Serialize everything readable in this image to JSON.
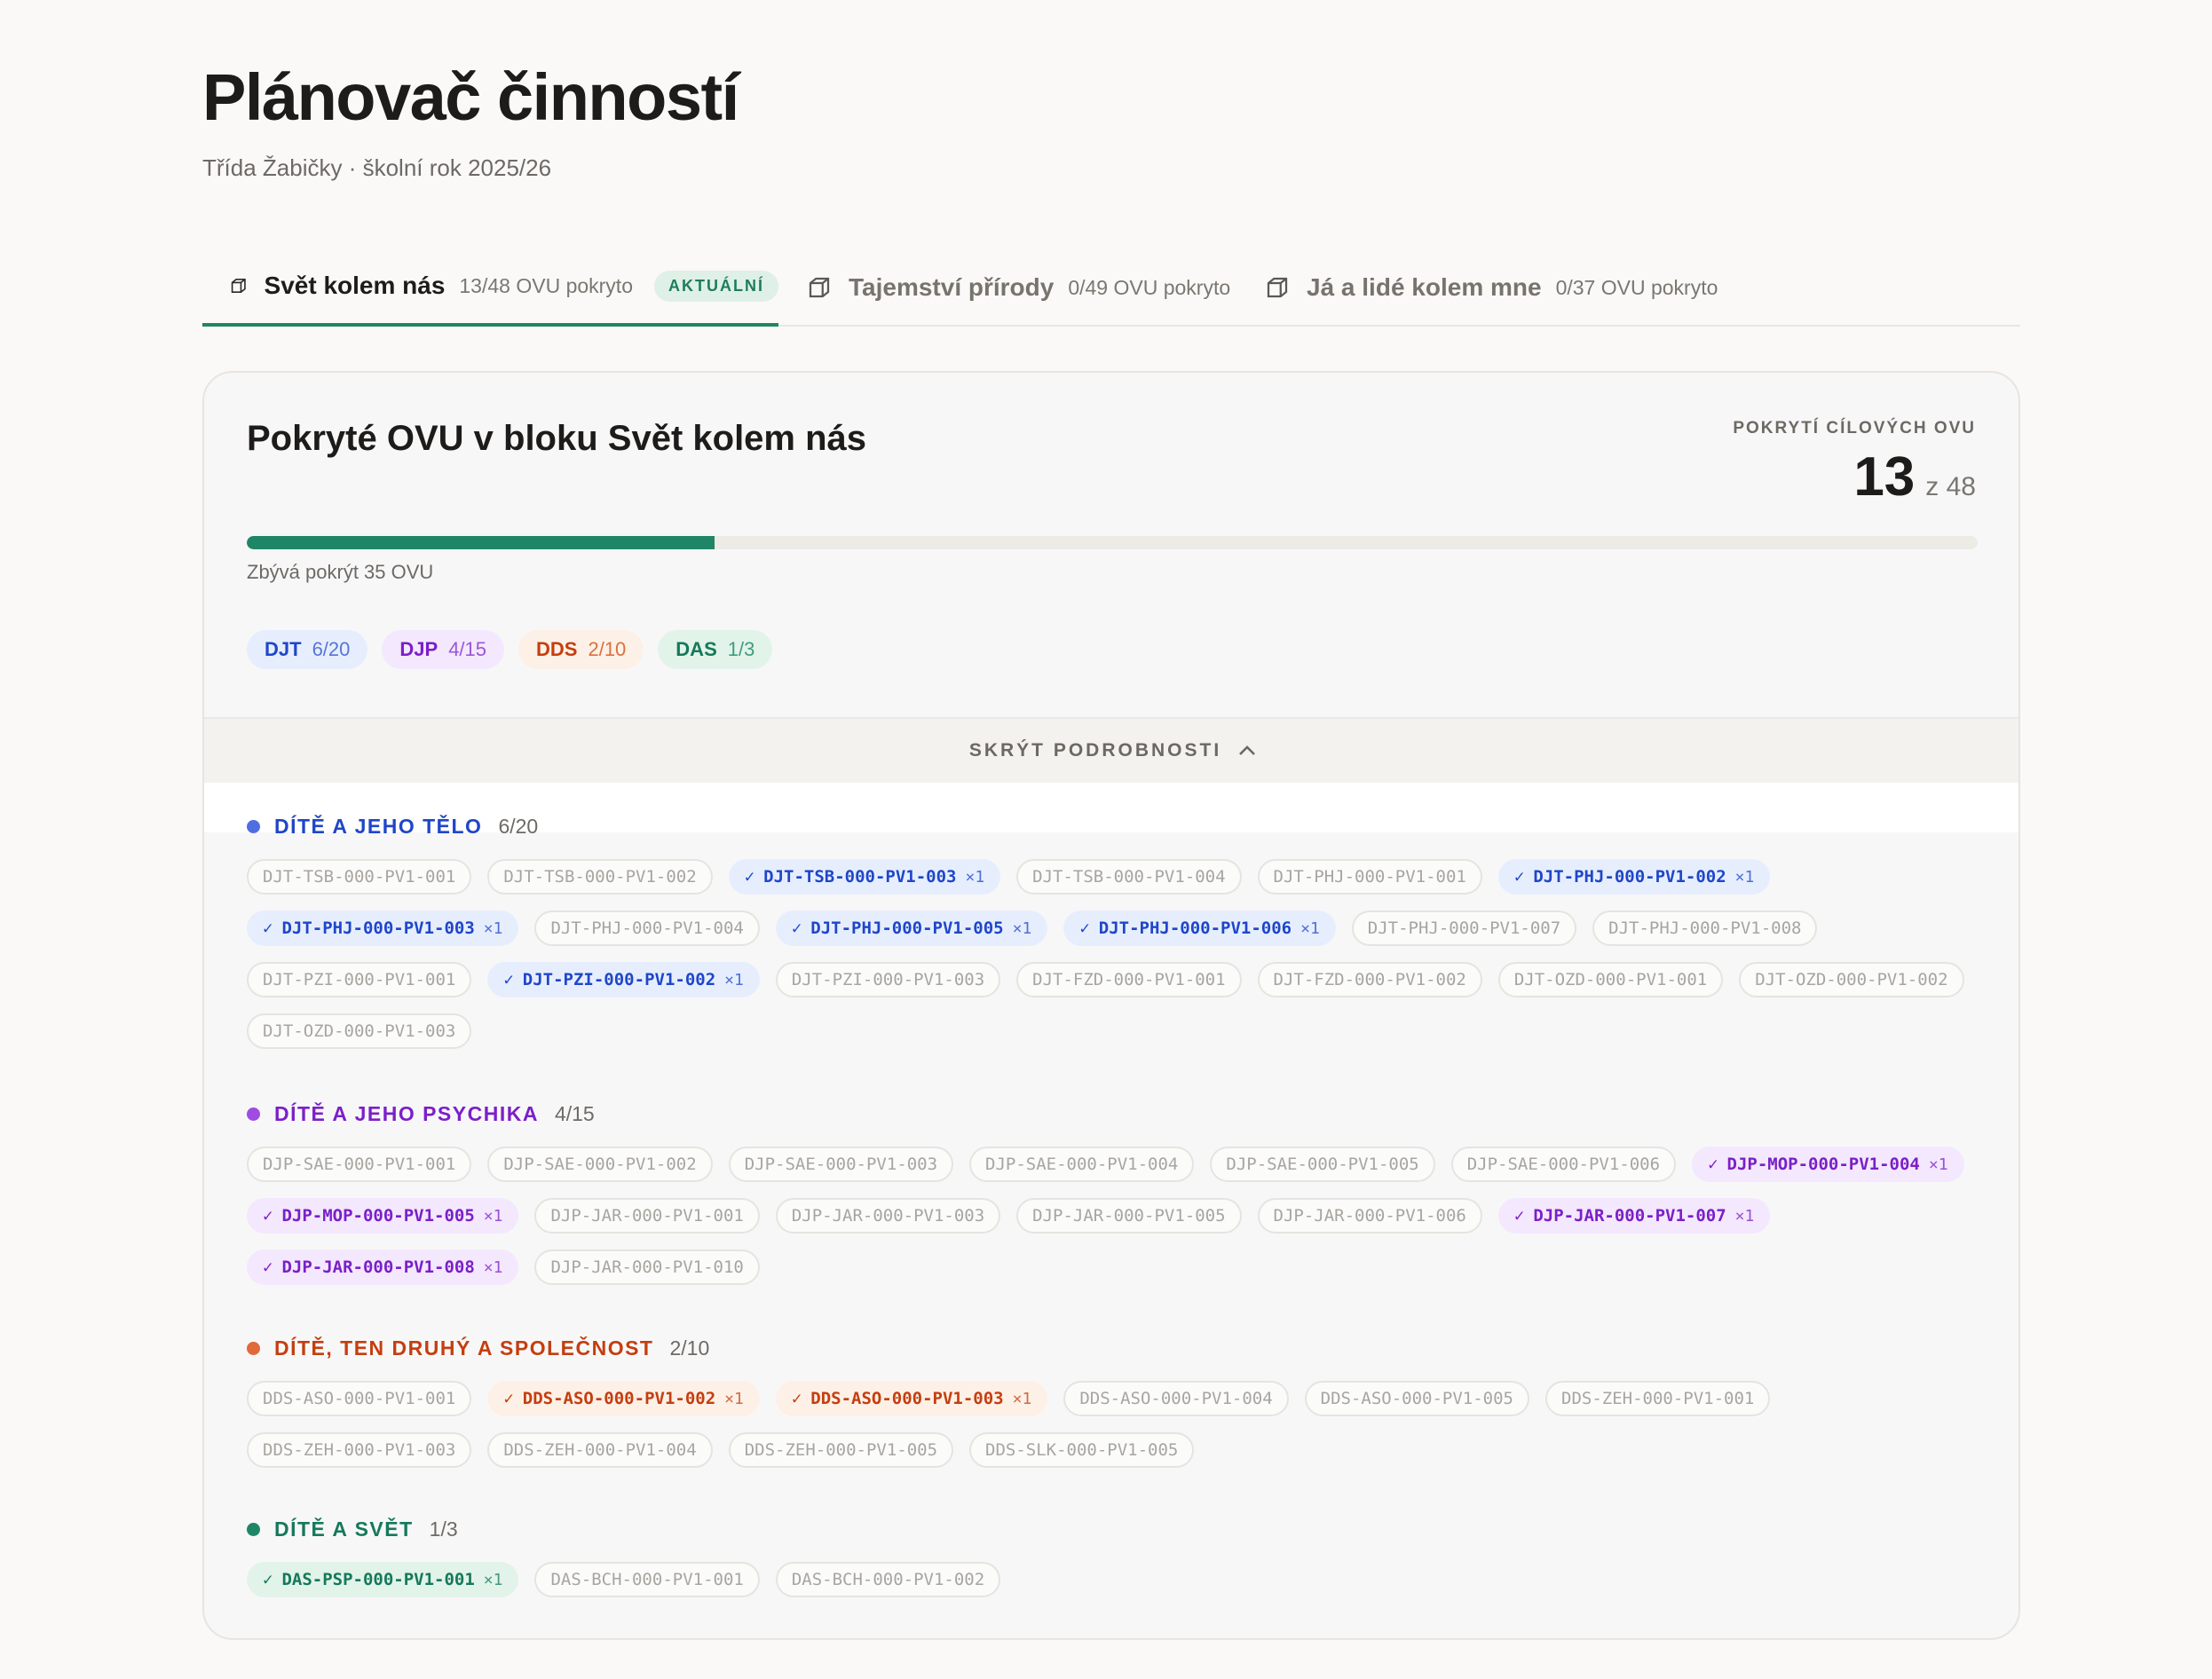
{
  "header": {
    "title": "Plánovač činností",
    "subtitle": "Třída Žabičky · školní rok 2025/26"
  },
  "tabs": [
    {
      "name": "Svět kolem nás",
      "count": "13/48 OVU pokryto",
      "badge": "AKTUÁLNÍ",
      "active": true,
      "icon": "box-icon"
    },
    {
      "name": "Tajemství přírody",
      "count": "0/49 OVU pokryto",
      "active": false,
      "icon": "box-icon"
    },
    {
      "name": "Já a lidé kolem mne",
      "count": "0/37 OVU pokryto",
      "active": false,
      "icon": "box-icon"
    }
  ],
  "card": {
    "title": "Pokryté OVU v bloku Svět kolem nás",
    "coverage_label": "POKRYTÍ CÍLOVÝCH OVU",
    "covered": "13",
    "total": "z 48",
    "progress_fraction": 0.27,
    "remaining": "Zbývá pokrýt 35 OVU",
    "toggle_label": "SKRÝT PODROBNOSTI",
    "summary": [
      {
        "code": "DJT",
        "count": "6/20"
      },
      {
        "code": "DJP",
        "count": "4/15"
      },
      {
        "code": "DDS",
        "count": "2/10"
      },
      {
        "code": "DAS",
        "count": "1/3"
      }
    ]
  },
  "groups": [
    {
      "name": "DÍTĚ A JEHO TĚLO",
      "count": "6/20",
      "items": [
        {
          "id": "DJT-TSB-000-PV1-001",
          "on": false
        },
        {
          "id": "DJT-TSB-000-PV1-002",
          "on": false
        },
        {
          "id": "DJT-TSB-000-PV1-003",
          "on": true,
          "mult": "×1"
        },
        {
          "id": "DJT-TSB-000-PV1-004",
          "on": false
        },
        {
          "id": "DJT-PHJ-000-PV1-001",
          "on": false
        },
        {
          "id": "DJT-PHJ-000-PV1-002",
          "on": true,
          "mult": "×1"
        },
        {
          "id": "DJT-PHJ-000-PV1-003",
          "on": true,
          "mult": "×1"
        },
        {
          "id": "DJT-PHJ-000-PV1-004",
          "on": false
        },
        {
          "id": "DJT-PHJ-000-PV1-005",
          "on": true,
          "mult": "×1"
        },
        {
          "id": "DJT-PHJ-000-PV1-006",
          "on": true,
          "mult": "×1"
        },
        {
          "id": "DJT-PHJ-000-PV1-007",
          "on": false
        },
        {
          "id": "DJT-PHJ-000-PV1-008",
          "on": false
        },
        {
          "id": "DJT-PZI-000-PV1-001",
          "on": false
        },
        {
          "id": "DJT-PZI-000-PV1-002",
          "on": true,
          "mult": "×1"
        },
        {
          "id": "DJT-PZI-000-PV1-003",
          "on": false
        },
        {
          "id": "DJT-FZD-000-PV1-001",
          "on": false
        },
        {
          "id": "DJT-FZD-000-PV1-002",
          "on": false
        },
        {
          "id": "DJT-OZD-000-PV1-001",
          "on": false
        },
        {
          "id": "DJT-OZD-000-PV1-002",
          "on": false
        },
        {
          "id": "DJT-OZD-000-PV1-003",
          "on": false
        }
      ]
    },
    {
      "name": "DÍTĚ A JEHO PSYCHIKA",
      "count": "4/15",
      "items": [
        {
          "id": "DJP-SAE-000-PV1-001",
          "on": false
        },
        {
          "id": "DJP-SAE-000-PV1-002",
          "on": false
        },
        {
          "id": "DJP-SAE-000-PV1-003",
          "on": false
        },
        {
          "id": "DJP-SAE-000-PV1-004",
          "on": false
        },
        {
          "id": "DJP-SAE-000-PV1-005",
          "on": false
        },
        {
          "id": "DJP-SAE-000-PV1-006",
          "on": false
        },
        {
          "id": "DJP-MOP-000-PV1-004",
          "on": true,
          "mult": "×1"
        },
        {
          "id": "DJP-MOP-000-PV1-005",
          "on": true,
          "mult": "×1"
        },
        {
          "id": "DJP-JAR-000-PV1-001",
          "on": false
        },
        {
          "id": "DJP-JAR-000-PV1-003",
          "on": false
        },
        {
          "id": "DJP-JAR-000-PV1-005",
          "on": false
        },
        {
          "id": "DJP-JAR-000-PV1-006",
          "on": false
        },
        {
          "id": "DJP-JAR-000-PV1-007",
          "on": true,
          "mult": "×1"
        },
        {
          "id": "DJP-JAR-000-PV1-008",
          "on": true,
          "mult": "×1"
        },
        {
          "id": "DJP-JAR-000-PV1-010",
          "on": false
        }
      ]
    },
    {
      "name": "DÍTĚ, TEN DRUHÝ A SPOLEČNOST",
      "count": "2/10",
      "items": [
        {
          "id": "DDS-ASO-000-PV1-001",
          "on": false
        },
        {
          "id": "DDS-ASO-000-PV1-002",
          "on": true,
          "mult": "×1"
        },
        {
          "id": "DDS-ASO-000-PV1-003",
          "on": true,
          "mult": "×1"
        },
        {
          "id": "DDS-ASO-000-PV1-004",
          "on": false
        },
        {
          "id": "DDS-ASO-000-PV1-005",
          "on": false
        },
        {
          "id": "DDS-ZEH-000-PV1-001",
          "on": false
        },
        {
          "id": "DDS-ZEH-000-PV1-003",
          "on": false
        },
        {
          "id": "DDS-ZEH-000-PV1-004",
          "on": false
        },
        {
          "id": "DDS-ZEH-000-PV1-005",
          "on": false
        },
        {
          "id": "DDS-SLK-000-PV1-005",
          "on": false
        }
      ]
    },
    {
      "name": "DÍTĚ A SVĚT",
      "count": "1/3",
      "items": [
        {
          "id": "DAS-PSP-000-PV1-001",
          "on": true,
          "mult": "×1"
        },
        {
          "id": "DAS-BCH-000-PV1-001",
          "on": false
        },
        {
          "id": "DAS-BCH-000-PV1-002",
          "on": false
        }
      ]
    }
  ],
  "colors": {
    "accent": "#1e8666",
    "DJT": {
      "main": "#1f46c9",
      "dot": "#4f6fe0",
      "bg": "#e6eefe",
      "soft": "#5a74d6"
    },
    "DJP": {
      "main": "#7b1fc9",
      "dot": "#a04be3",
      "bg": "#f3e8fd",
      "soft": "#9a56d8"
    },
    "DDS": {
      "main": "#c43e0f",
      "dot": "#e06a3a",
      "bg": "#fdf0e6",
      "soft": "#d9713f"
    },
    "DAS": {
      "main": "#15795a",
      "dot": "#1e8666",
      "bg": "#e2f3ea",
      "soft": "#3f9d7c"
    }
  }
}
